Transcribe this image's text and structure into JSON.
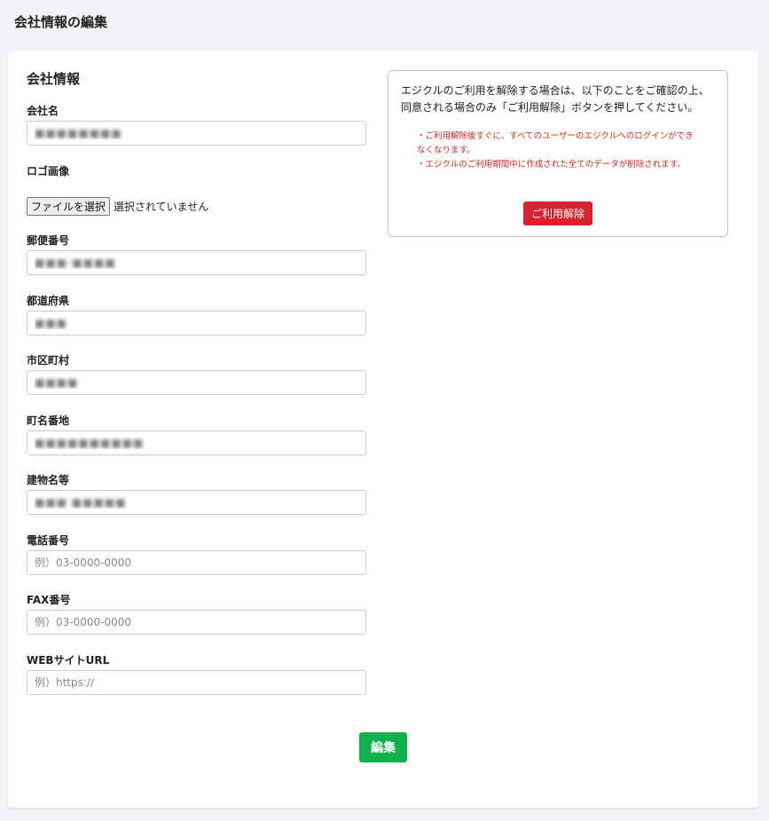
{
  "page": {
    "title": "会社情報の編集"
  },
  "form": {
    "section_title": "会社情報",
    "fields": {
      "company_name": {
        "label": "会社名",
        "value": "■■■■■■■■",
        "placeholder": ""
      },
      "logo": {
        "label": "ロゴ画像",
        "button_label": "ファイルを選択",
        "status": "選択されていません"
      },
      "postal_code": {
        "label": "郵便番号",
        "value": "■■■-■■■■",
        "placeholder": ""
      },
      "prefecture": {
        "label": "都道府県",
        "value": "■■■",
        "placeholder": ""
      },
      "city": {
        "label": "市区町村",
        "value": "■■■■",
        "placeholder": ""
      },
      "street": {
        "label": "町名番地",
        "value": "■■■■■■■■■■",
        "placeholder": ""
      },
      "building": {
        "label": "建物名等",
        "value": "■■■ ■■■■■",
        "placeholder": ""
      },
      "phone": {
        "label": "電話番号",
        "value": "",
        "placeholder": "例）03-0000-0000"
      },
      "fax": {
        "label": "FAX番号",
        "value": "",
        "placeholder": "例）03-0000-0000"
      },
      "website": {
        "label": "WEBサイトURL",
        "value": "",
        "placeholder": "例）https://"
      }
    },
    "submit_label": "編集"
  },
  "notice": {
    "text": "エジクルのご利用を解除する場合は、以下のことをご確認の上、同意される場合のみ「ご利用解除」ボタンを押してください。",
    "warnings": [
      "・ご利用解除後すぐに、すべてのユーザーのエジクルへのログインができなくなります。",
      "・エジクルのご利用期間中に作成された全てのデータが削除されます。"
    ],
    "button_label": "ご利用解除"
  },
  "colors": {
    "background": "#f1f3f6",
    "danger": "#d7232f",
    "success": "#0fb24a"
  }
}
